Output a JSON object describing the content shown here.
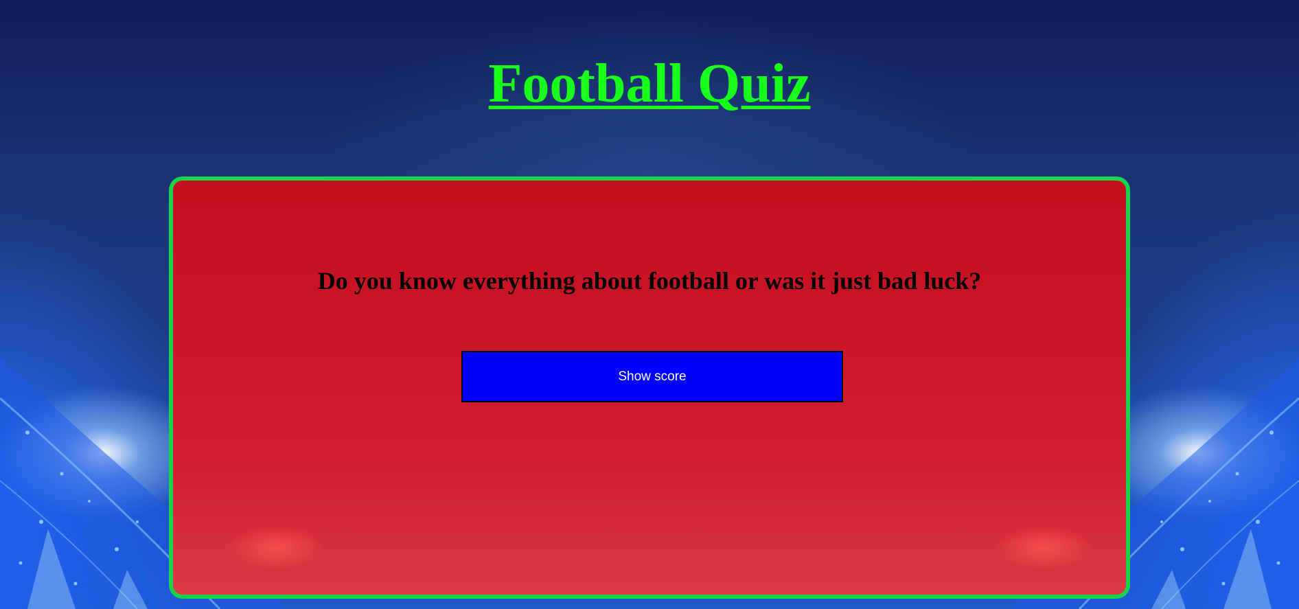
{
  "page": {
    "title": "Football Quiz",
    "question": "Do you know everything about football or was it just bad luck?",
    "show_score_label": "Show score"
  },
  "colors": {
    "title": "#19ff1c",
    "card_border": "#19d34a",
    "card_background": "#c91528",
    "button_background": "#0000ff",
    "button_text": "#ffffff",
    "question_text": "#000000"
  },
  "background": {
    "scene": "stadium-lights-icon"
  }
}
